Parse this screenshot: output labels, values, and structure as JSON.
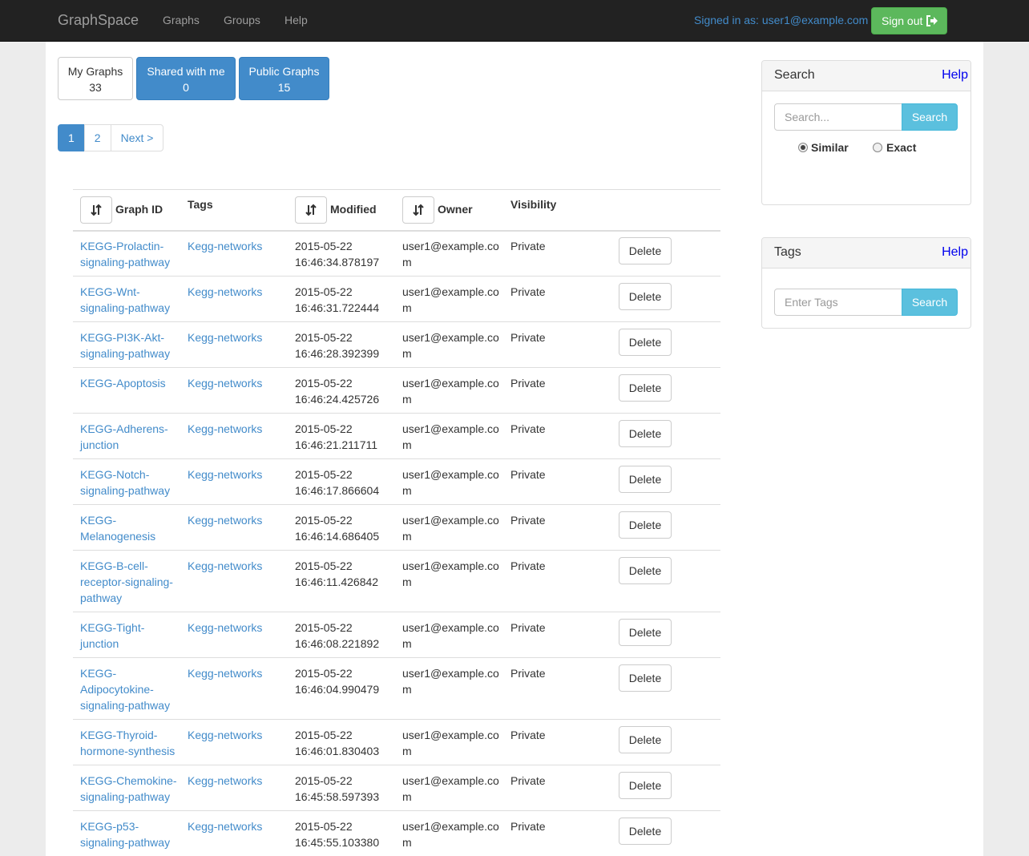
{
  "navbar": {
    "brand": "GraphSpace",
    "links": [
      "Graphs",
      "Groups",
      "Help"
    ],
    "signed_in": "Signed in as: user1@example.com",
    "signout_label": "Sign out"
  },
  "counts": [
    {
      "label": "My Graphs",
      "count": "33"
    },
    {
      "label": "Shared with me",
      "count": "0"
    },
    {
      "label": "Public Graphs",
      "count": "15"
    }
  ],
  "pagination": {
    "pages": [
      "1",
      "2"
    ],
    "next": "Next >"
  },
  "table": {
    "headers": {
      "graph_id": "Graph ID",
      "tags": "Tags",
      "modified": "Modified",
      "owner": "Owner",
      "visibility": "Visibility"
    },
    "delete_label": "Delete",
    "rows": [
      {
        "id": "KEGG-Prolactin-signaling-pathway",
        "tag": "Kegg-networks",
        "modified": "2015-05-22 16:46:34.878197",
        "owner": "user1@example.com",
        "visibility": "Private"
      },
      {
        "id": "KEGG-Wnt-signaling-pathway",
        "tag": "Kegg-networks",
        "modified": "2015-05-22 16:46:31.722444",
        "owner": "user1@example.com",
        "visibility": "Private"
      },
      {
        "id": "KEGG-PI3K-Akt-signaling-pathway",
        "tag": "Kegg-networks",
        "modified": "2015-05-22 16:46:28.392399",
        "owner": "user1@example.com",
        "visibility": "Private"
      },
      {
        "id": "KEGG-Apoptosis",
        "tag": "Kegg-networks",
        "modified": "2015-05-22 16:46:24.425726",
        "owner": "user1@example.com",
        "visibility": "Private"
      },
      {
        "id": "KEGG-Adherens-junction",
        "tag": "Kegg-networks",
        "modified": "2015-05-22 16:46:21.211711",
        "owner": "user1@example.com",
        "visibility": "Private"
      },
      {
        "id": "KEGG-Notch-signaling-pathway",
        "tag": "Kegg-networks",
        "modified": "2015-05-22 16:46:17.866604",
        "owner": "user1@example.com",
        "visibility": "Private"
      },
      {
        "id": "KEGG-Melanogenesis",
        "tag": "Kegg-networks",
        "modified": "2015-05-22 16:46:14.686405",
        "owner": "user1@example.com",
        "visibility": "Private"
      },
      {
        "id": "KEGG-B-cell-receptor-signaling-pathway",
        "tag": "Kegg-networks",
        "modified": "2015-05-22 16:46:11.426842",
        "owner": "user1@example.com",
        "visibility": "Private"
      },
      {
        "id": "KEGG-Tight-junction",
        "tag": "Kegg-networks",
        "modified": "2015-05-22 16:46:08.221892",
        "owner": "user1@example.com",
        "visibility": "Private"
      },
      {
        "id": "KEGG-Adipocytokine-signaling-pathway",
        "tag": "Kegg-networks",
        "modified": "2015-05-22 16:46:04.990479",
        "owner": "user1@example.com",
        "visibility": "Private"
      },
      {
        "id": "KEGG-Thyroid-hormone-synthesis",
        "tag": "Kegg-networks",
        "modified": "2015-05-22 16:46:01.830403",
        "owner": "user1@example.com",
        "visibility": "Private"
      },
      {
        "id": "KEGG-Chemokine-signaling-pathway",
        "tag": "Kegg-networks",
        "modified": "2015-05-22 16:45:58.597393",
        "owner": "user1@example.com",
        "visibility": "Private"
      },
      {
        "id": "KEGG-p53-signaling-pathway",
        "tag": "Kegg-networks",
        "modified": "2015-05-22 16:45:55.103380",
        "owner": "user1@example.com",
        "visibility": "Private"
      }
    ]
  },
  "search_panel": {
    "title": "Search",
    "help": "Help",
    "placeholder": "Search...",
    "button": "Search",
    "options": [
      {
        "label": "Similar",
        "checked": true
      },
      {
        "label": "Exact",
        "checked": false
      }
    ]
  },
  "tags_panel": {
    "title": "Tags",
    "help": "Help",
    "placeholder": "Enter Tags",
    "button": "Search"
  },
  "icons": {
    "sort": "sort-icon",
    "signout": "sign-out-icon"
  }
}
